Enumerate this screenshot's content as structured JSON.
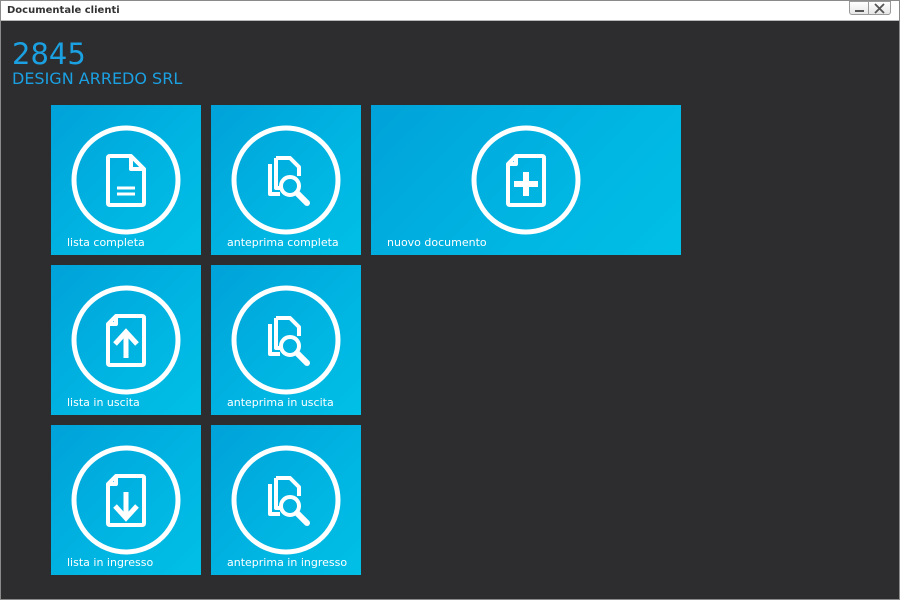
{
  "window": {
    "title": "Documentale clienti",
    "minimize_icon": "minimize-icon",
    "close_icon": "close-icon"
  },
  "header": {
    "code": "2845",
    "company": "DESIGN ARREDO SRL"
  },
  "colors": {
    "accent": "#1ba1e2",
    "tile": "#00b4e2",
    "background": "#2d2c2f"
  },
  "tiles": [
    {
      "label": "lista completa",
      "icon": "document-icon"
    },
    {
      "label": "anteprima completa",
      "icon": "document-search-icon"
    },
    {
      "label": "nuovo documento",
      "icon": "document-add-icon"
    },
    {
      "label": "lista in uscita",
      "icon": "document-upload-icon"
    },
    {
      "label": "anteprima in uscita",
      "icon": "document-search-icon"
    },
    {
      "label": "lista in ingresso",
      "icon": "document-download-icon"
    },
    {
      "label": "anteprima in ingresso",
      "icon": "document-search-icon"
    }
  ]
}
